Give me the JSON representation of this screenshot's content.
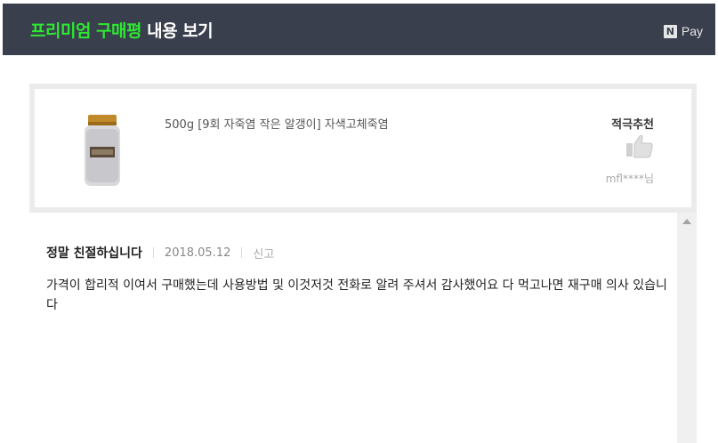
{
  "header": {
    "title_green": "프리미엄 구매평",
    "title_white": "내용 보기",
    "npay_badge": "N",
    "npay_label": "Pay"
  },
  "product": {
    "name": "500g [9회 자죽염 작은 알갱이] 자색고체죽염",
    "recommendation": "적극추천",
    "user": "mfl****님"
  },
  "review": {
    "title": "정말 친절하십니다",
    "date": "2018.05.12",
    "report_label": "신고",
    "body": "가격이 합리적 이여서 구매했는데 사용방법 및 이것저것 전화로 알려 주셔서 감사했어요 다 먹고나면 재구매 의사 있습니다"
  },
  "colors": {
    "header_bg": "#3a3f4d",
    "accent_green": "#2ee832"
  }
}
